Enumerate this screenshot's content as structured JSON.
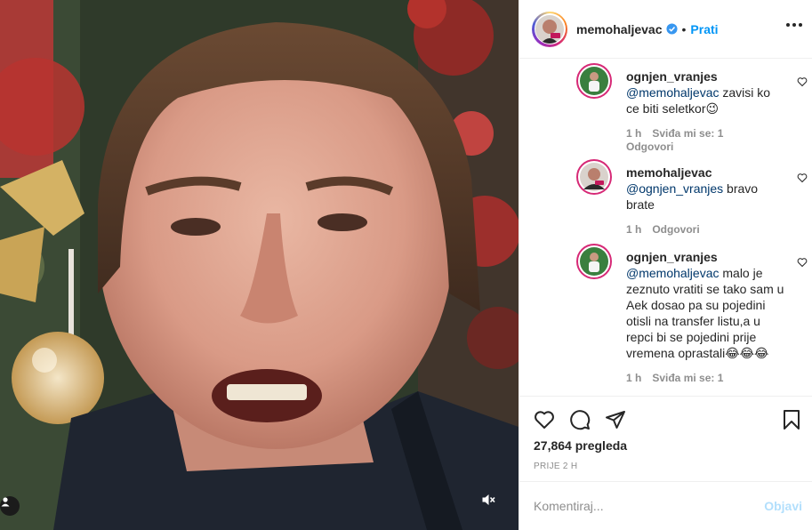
{
  "post": {
    "author": "memohaljevac",
    "follow_label": "Prati",
    "separator": "•",
    "views": "27,864 pregleda",
    "time_ago": "PRIJE 2 H"
  },
  "comments": [
    {
      "username": "ognjen_vranjes",
      "mention": "@memohaljevac",
      "text": " zavisi ko ce biti seletkor😉",
      "time": "1 h",
      "likes": "Sviđa mi se: 1",
      "reply": "Odgovori"
    },
    {
      "username": "memohaljevac",
      "mention": "@ognjen_vranjes",
      "text": " bravo brate",
      "time": "1 h",
      "reply": "Odgovori"
    },
    {
      "username": "ognjen_vranjes",
      "mention": "@memohaljevac",
      "text": " malo je zeznuto vratiti se tako sam u Aek dosao pa su pojedini otisli na transfer listu,a u repci bi se pojedini prije vremena oprastali😂😂😂",
      "time": "1 h",
      "likes": "Sviđa mi se: 1"
    }
  ],
  "compose": {
    "placeholder": "Komentiraj...",
    "post_label": "Objavi"
  },
  "colors": {
    "accent": "#0095f6",
    "mention": "#00376b",
    "muted": "#8e8e8e",
    "post_disabled": "#b2dffc"
  },
  "icons": [
    "verified-badge-icon",
    "more-options-icon",
    "heart-icon",
    "comment-icon",
    "share-icon",
    "save-icon",
    "mute-icon",
    "user-tag-icon"
  ]
}
